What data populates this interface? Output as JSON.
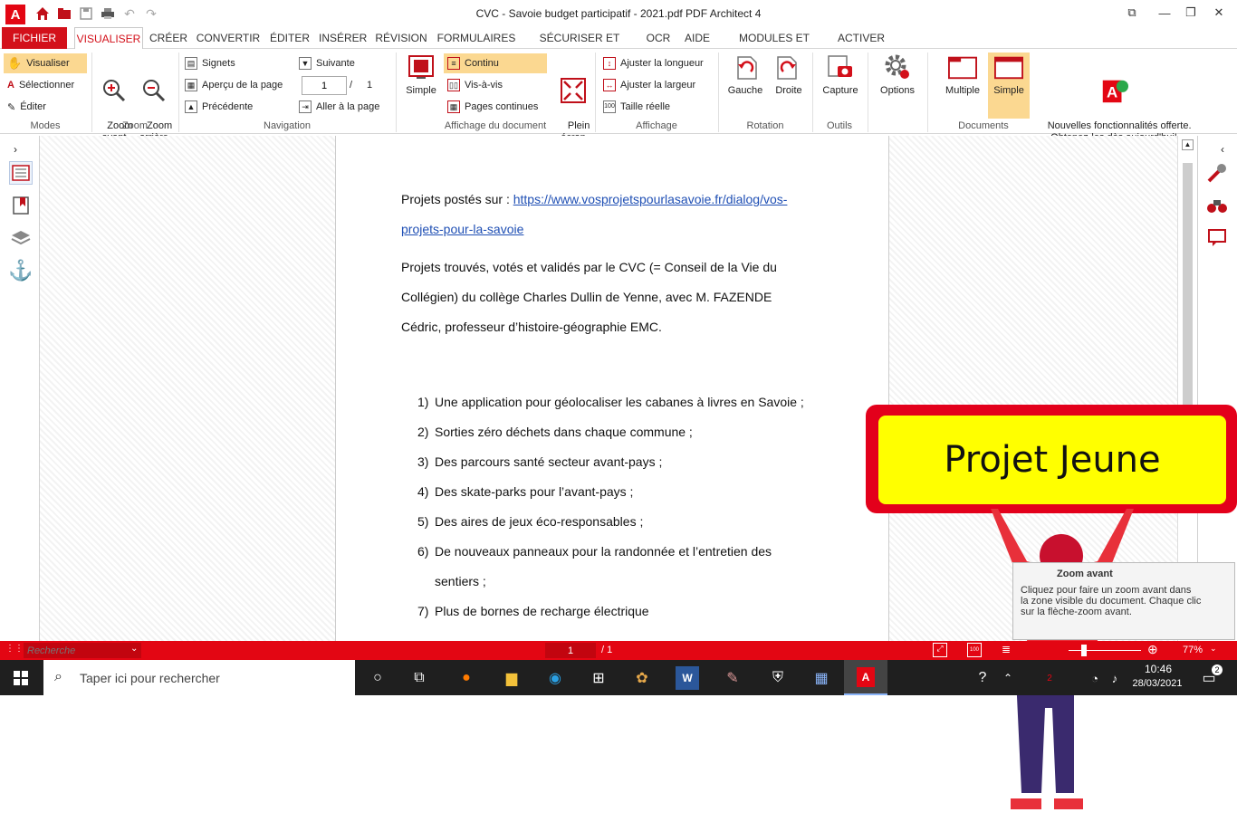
{
  "window": {
    "title": "CVC - Savoie budget participatif - 2021.pdf    PDF Architect 4"
  },
  "menu": {
    "items": [
      "FICHIER",
      "VISUALISER",
      "CRÉER",
      "CONVERTIR",
      "ÉDITER",
      "INSÉRER",
      "RÉVISION",
      "FORMULAIRES",
      "SÉCURISER ET SIGNER",
      "OCR",
      "AIDE",
      "MODULES ET PACKS",
      "ACTIVER"
    ]
  },
  "ribbon": {
    "modes": {
      "label": "Modes",
      "visualiser": "Visualiser",
      "selectionner": "Sélectionner",
      "editer": "Éditer"
    },
    "zoom": {
      "label": "Zoom",
      "in": "Zoom\navant",
      "out": "Zoom\narrière"
    },
    "navigation": {
      "label": "Navigation",
      "signets": "Signets",
      "apercu": "Aperçu de la page",
      "precedente": "Précédente",
      "suivante": "Suivante",
      "page_value": "1",
      "page_sep": "/",
      "page_total": "1",
      "aller": "Aller à la page"
    },
    "affichage_doc": {
      "label": "Affichage du document",
      "simple": "Simple",
      "continu": "Continu",
      "visavis": "Vis-à-vis",
      "pages_continues": "Pages continues",
      "plein_ecran": "Plein\nécran"
    },
    "affichage": {
      "label": "Affichage",
      "longueur": "Ajuster la longueur",
      "largeur": "Ajuster la largeur",
      "taille": "Taille réelle"
    },
    "rotation": {
      "label": "Rotation",
      "gauche": "Gauche",
      "droite": "Droite"
    },
    "outils": {
      "label": "Outils",
      "capture": "Capture"
    },
    "options": {
      "label": "Options"
    },
    "documents": {
      "label": "Documents",
      "multiple": "Multiple",
      "simple": "Simple",
      "promo": "Nouvelles fonctionnalités offerte.\nObtenez-les dès aujourd'hui!"
    }
  },
  "document": {
    "intro_label": "Projets postés sur : ",
    "link_line1": "https://www.vosprojetspourlasavoie.fr/dialog/vos-",
    "link_line2": "projets-pour-la-savoie",
    "para_line1": "Projets trouvés, votés et validés par le CVC (= Conseil de la Vie du",
    "para_line2": "Collégien) du collège Charles Dullin de Yenne, avec M. FAZENDE",
    "para_line3": "Cédric, professeur d’histoire-géographie EMC.",
    "list": [
      {
        "num": "1)",
        "text": "Une application pour géolocaliser les cabanes à livres en Savoie ;"
      },
      {
        "num": "2)",
        "text": "Sorties zéro déchets dans chaque commune ;"
      },
      {
        "num": "3)",
        "text": "Des parcours santé secteur avant-pays ;"
      },
      {
        "num": "4)",
        "text": "Des skate-parks pour l’avant-pays ;"
      },
      {
        "num": "5)",
        "text": "Des aires de jeux éco-responsables ;"
      },
      {
        "num": "6)",
        "text": "De nouveaux panneaux pour la randonnée et l’entretien des"
      },
      {
        "num": "",
        "text": "sentiers ;"
      },
      {
        "num": "7)",
        "text": "Plus de bornes de recharge électrique"
      }
    ]
  },
  "overlay": {
    "sign_text": "Projet Jeune"
  },
  "tooltip": {
    "title": "Zoom avant",
    "line1": "Cliquez pour faire un zoom avant dans",
    "line2": "la zone visible du document. Chaque clic",
    "line3": "sur la flèche-zoom avant."
  },
  "statusbar": {
    "search_placeholder": "Recherche",
    "page_value": "1",
    "page_total": "/ 1",
    "zoom": "77%"
  },
  "taskbar": {
    "search_placeholder": "Taper ici pour rechercher",
    "time": "10:46",
    "date": "28/03/2021",
    "notif_count": "2"
  },
  "colors": {
    "brand": "#e30613",
    "active": "#fbd891"
  }
}
